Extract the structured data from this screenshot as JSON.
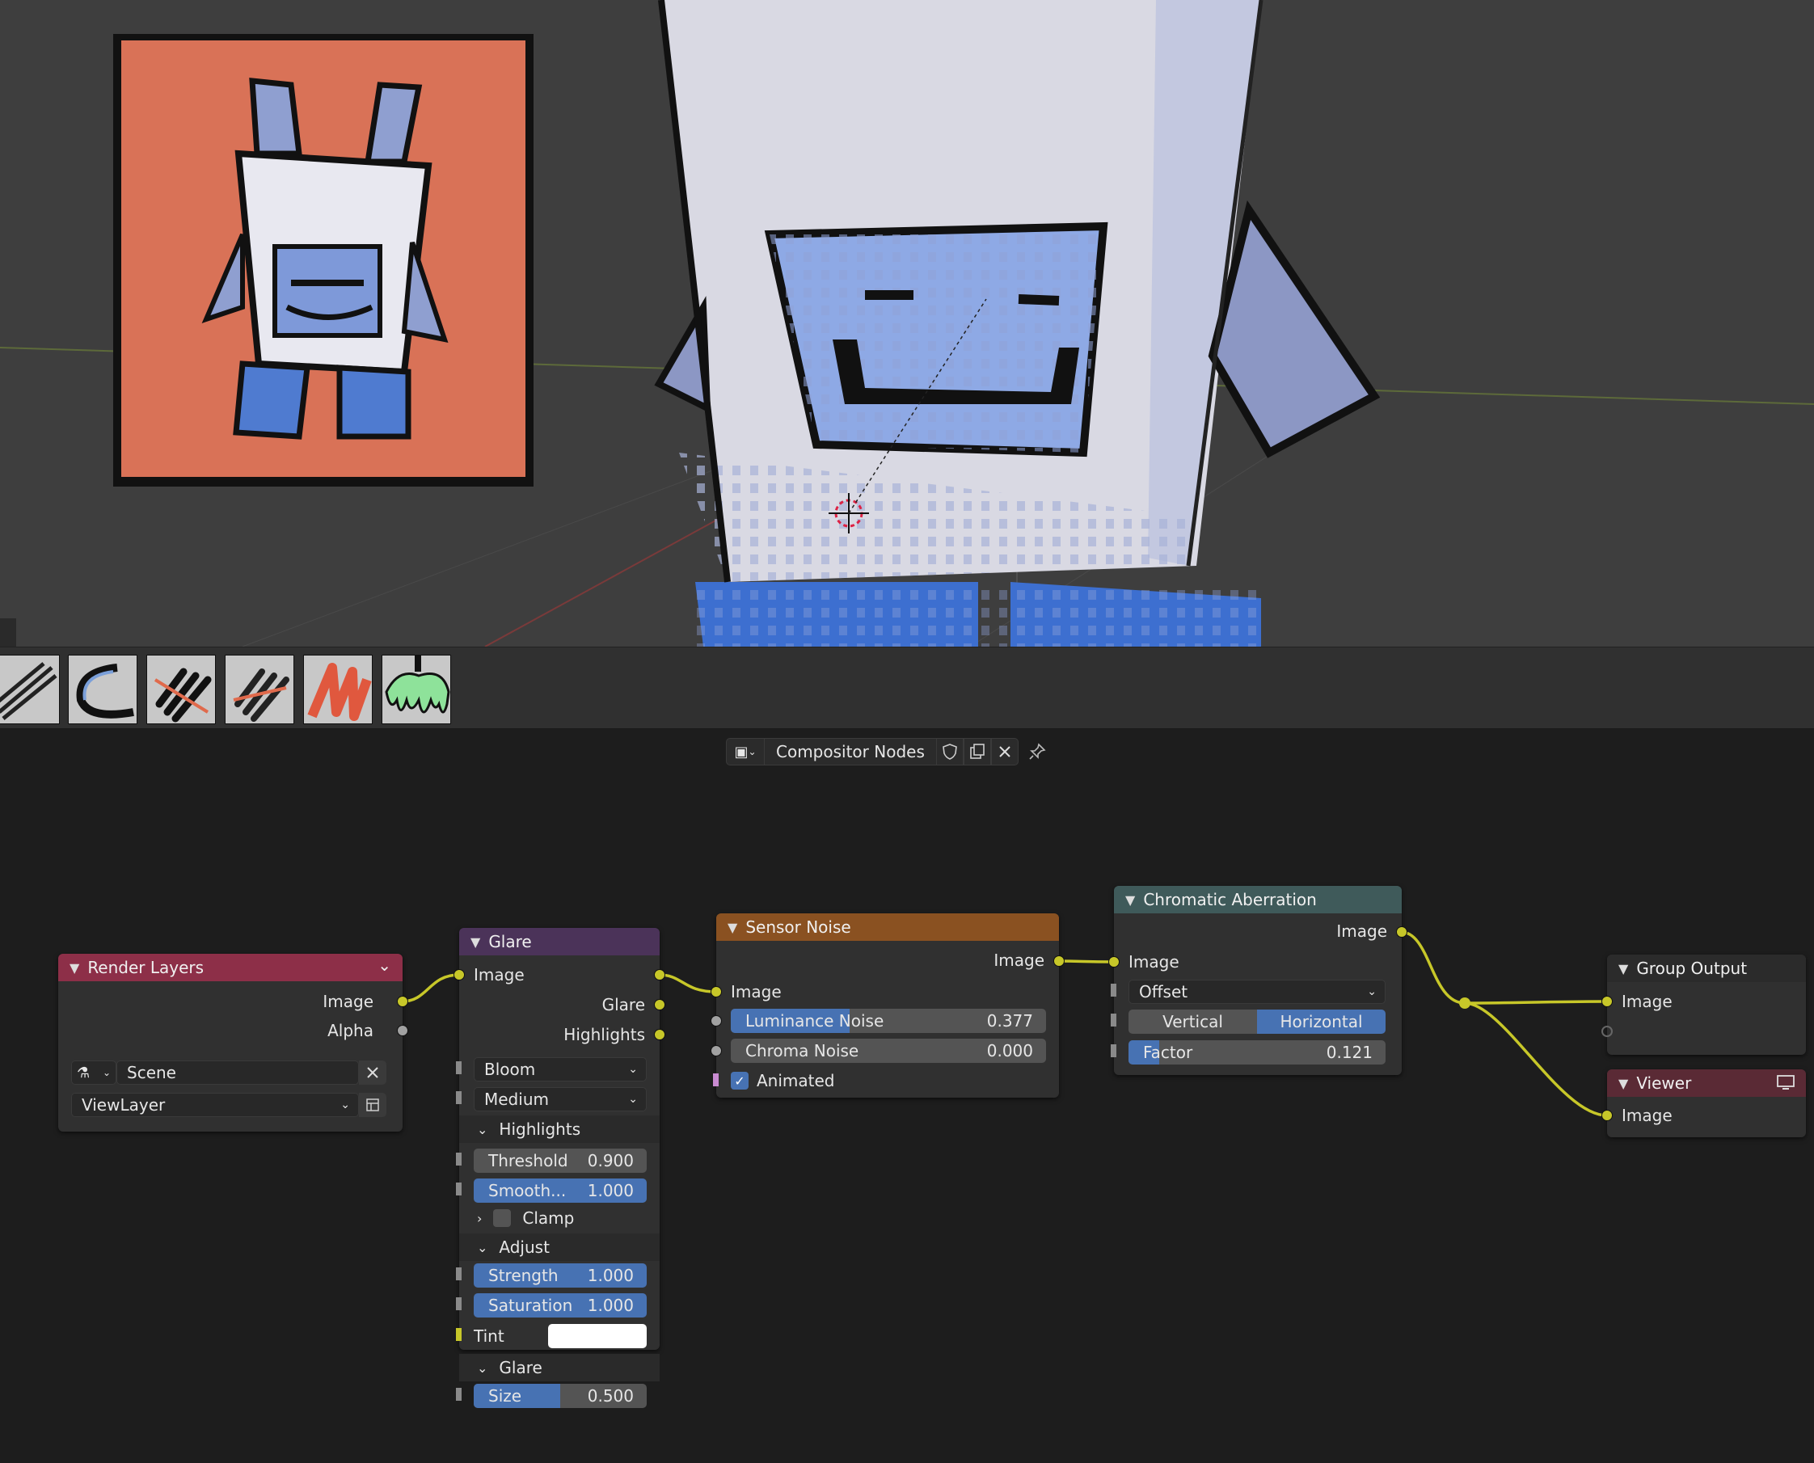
{
  "editor": {
    "title": "Compositor Nodes"
  },
  "brushes": [
    "brush-pencil-icon",
    "brush-ink-curve-icon",
    "brush-marker-icon",
    "brush-marker-alt-icon",
    "brush-crayon-icon",
    "brush-drip-icon"
  ],
  "nodes": {
    "render_layers": {
      "title": "Render Layers",
      "out_image": "Image",
      "out_alpha": "Alpha",
      "scene": "Scene",
      "view_layer": "ViewLayer",
      "color": "#8d2f48"
    },
    "glare": {
      "title": "Glare",
      "in_image": "Image",
      "out_glare": "Glare",
      "out_highlights": "Highlights",
      "type": "Bloom",
      "quality": "Medium",
      "highlights_panel": "Highlights",
      "threshold_label": "Threshold",
      "threshold_value": "0.900",
      "smooth_label": "Smooth...",
      "smooth_value": "1.000",
      "clamp_label": "Clamp",
      "adjust_panel": "Adjust",
      "strength_label": "Strength",
      "strength_value": "1.000",
      "saturation_label": "Saturation",
      "saturation_value": "1.000",
      "tint_label": "Tint",
      "glare_panel": "Glare",
      "size_label": "Size",
      "size_value": "0.500",
      "color": "#4b3359"
    },
    "sensor_noise": {
      "title": "Sensor Noise",
      "out_image": "Image",
      "in_image": "Image",
      "lum_label": "Luminance Noise",
      "lum_value": "0.377",
      "lum_fraction": 0.377,
      "chroma_label": "Chroma Noise",
      "chroma_value": "0.000",
      "animated_label": "Animated",
      "animated": true,
      "color": "#8a5121"
    },
    "chromatic": {
      "title": "Chromatic Aberration",
      "out_image": "Image",
      "in_image": "Image",
      "mode": "Offset",
      "vertical": "Vertical",
      "horizontal": "Horizontal",
      "factor_label": "Factor",
      "factor_value": "0.121",
      "factor_fraction": 0.121,
      "color": "#3f5a5a"
    },
    "group_output": {
      "title": "Group Output",
      "in_image": "Image",
      "color": "#2b2b2b"
    },
    "viewer": {
      "title": "Viewer",
      "in_image": "Image",
      "color": "#5a2a35"
    }
  }
}
